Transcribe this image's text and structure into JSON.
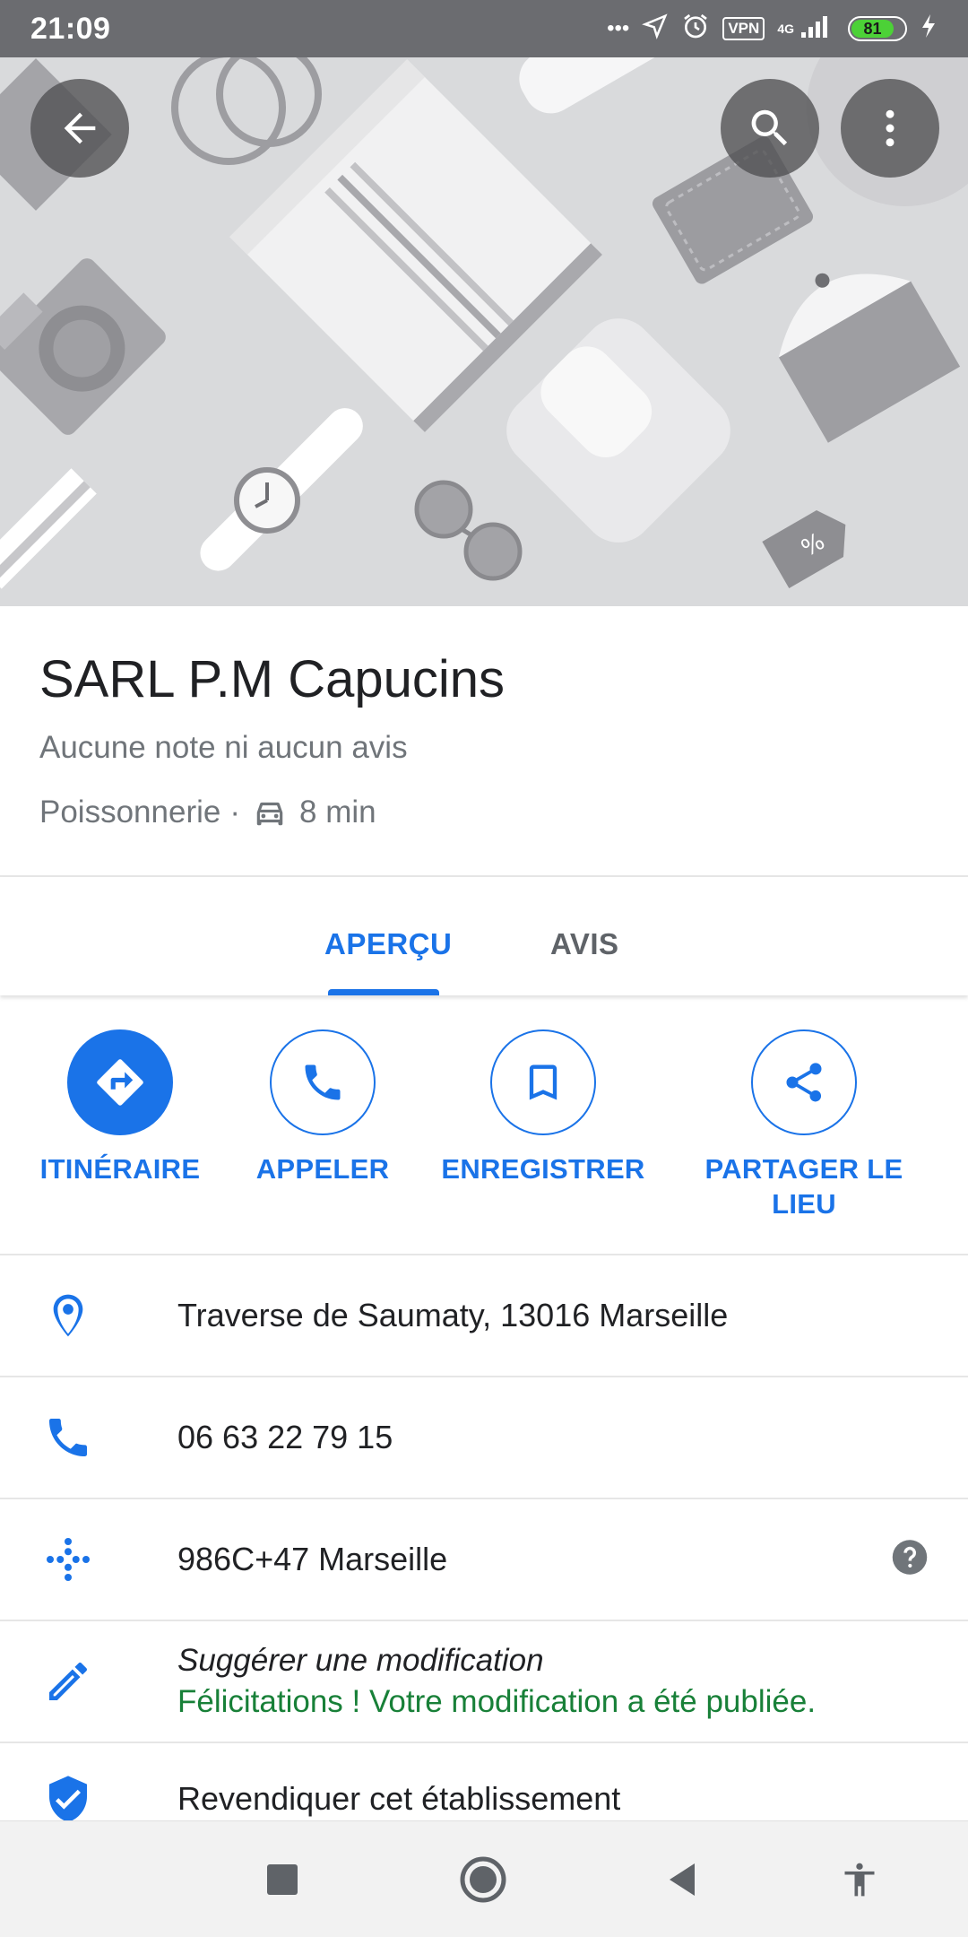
{
  "status_bar": {
    "time": "21:09",
    "dots": "•••",
    "vpn_label": "VPN",
    "network_label": "4G",
    "battery_level": "81",
    "icons": [
      "location-arrow-icon",
      "alarm-icon",
      "signal-icon",
      "battery-icon",
      "charging-icon"
    ]
  },
  "hero": {
    "buttons": [
      "back-arrow-icon",
      "search-icon",
      "more-vert-icon"
    ]
  },
  "place": {
    "name": "SARL P.M Capucins",
    "rating_text": "Aucune note ni aucun avis",
    "category": "Poissonnerie",
    "separator": "·",
    "drive_time": "8 min"
  },
  "tabs": [
    {
      "label": "APERÇU",
      "active": true
    },
    {
      "label": "AVIS",
      "active": false
    }
  ],
  "actions": [
    {
      "label": "ITINÉRAIRE",
      "icon": "directions-icon"
    },
    {
      "label": "APPELER",
      "icon": "phone-icon"
    },
    {
      "label": "ENREGISTRER",
      "icon": "bookmark-icon"
    },
    {
      "label": "PARTAGER LE LIEU",
      "icon": "share-icon"
    }
  ],
  "info": {
    "address": "Traverse de Saumaty, 13016 Marseille",
    "phone": "06 63 22 79 15",
    "plus_code": "986C+47 Marseille",
    "suggest_title": "Suggérer une modification",
    "suggest_sub": "Félicitations ! Votre modification a été publiée.",
    "claim": "Revendiquer cet établissement"
  },
  "colors": {
    "accent": "#1a73e8",
    "success": "#188038",
    "status_bar": "#6b6c70"
  }
}
